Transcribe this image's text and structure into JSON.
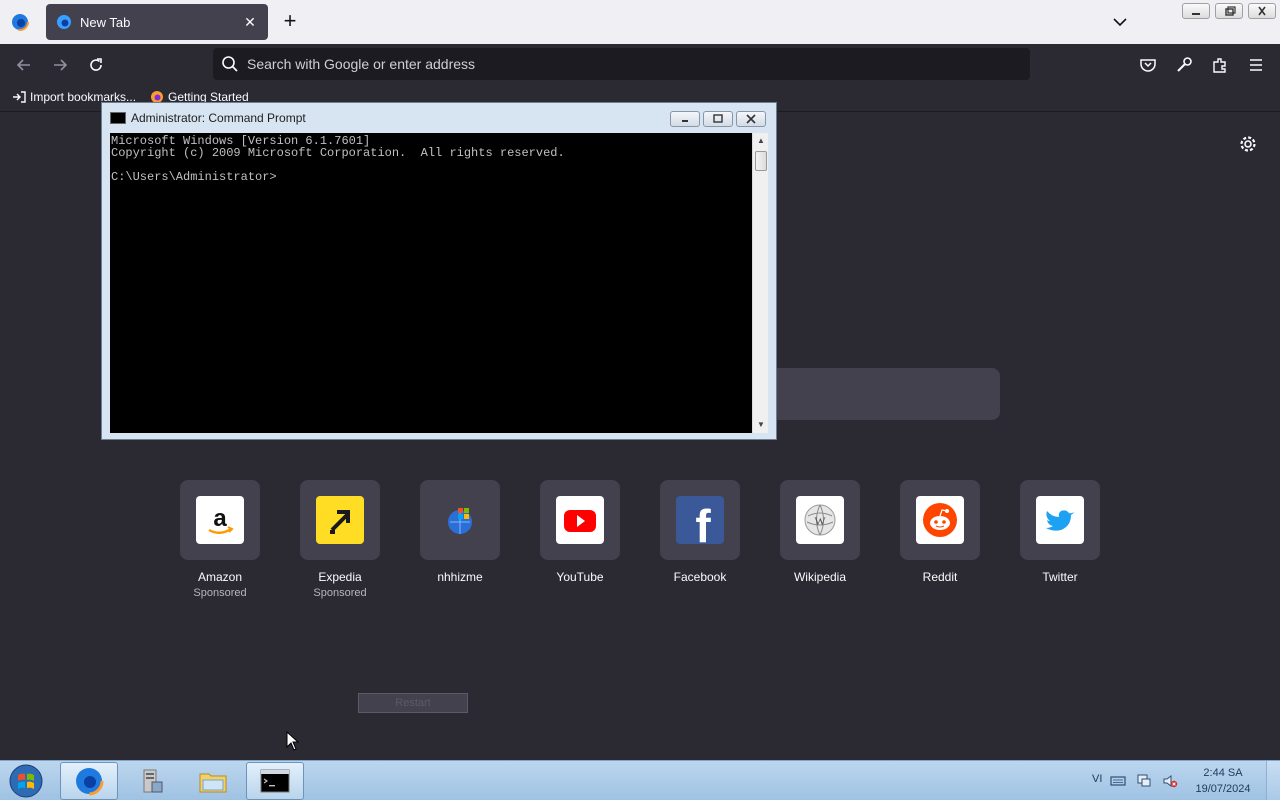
{
  "browser": {
    "tab": {
      "title": "New Tab",
      "close_glyph": "✕"
    },
    "new_tab_glyph": "+",
    "urlbar": {
      "placeholder": "Search with Google or enter address"
    },
    "bookmarks": [
      {
        "label": "Import bookmarks...",
        "icon": "import-icon"
      },
      {
        "label": "Getting Started",
        "icon": "firefox-icon"
      }
    ]
  },
  "newtab": {
    "tiles": [
      {
        "label": "Amazon",
        "sponsored": "Sponsored",
        "icon": "amazon-icon"
      },
      {
        "label": "Expedia",
        "sponsored": "Sponsored",
        "icon": "expedia-icon"
      },
      {
        "label": "nhhizme",
        "sponsored": "",
        "icon": "windows-globe-icon"
      },
      {
        "label": "YouTube",
        "sponsored": "",
        "icon": "youtube-icon"
      },
      {
        "label": "Facebook",
        "sponsored": "",
        "icon": "facebook-icon"
      },
      {
        "label": "Wikipedia",
        "sponsored": "",
        "icon": "wikipedia-icon"
      },
      {
        "label": "Reddit",
        "sponsored": "",
        "icon": "reddit-icon"
      },
      {
        "label": "Twitter",
        "sponsored": "",
        "icon": "twitter-icon"
      }
    ],
    "restart_label": "Restart"
  },
  "cmd": {
    "title": "Administrator: Command Prompt",
    "lines": [
      "Microsoft Windows [Version 6.1.7601]",
      "Copyright (c) 2009 Microsoft Corporation.  All rights reserved.",
      "",
      "C:\\Users\\Administrator>"
    ]
  },
  "taskbar": {
    "language": "VI",
    "clock_time": "2:44 SA",
    "clock_date": "19/07/2024",
    "apps": [
      "firefox-icon",
      "server-manager-icon",
      "explorer-folder-icon",
      "cmd-icon"
    ]
  },
  "colors": {
    "browser_bg": "#2b2a33",
    "urlbar_bg": "#1c1b22",
    "tile_bg": "#42414d",
    "taskbar": "#a9c9e8"
  }
}
